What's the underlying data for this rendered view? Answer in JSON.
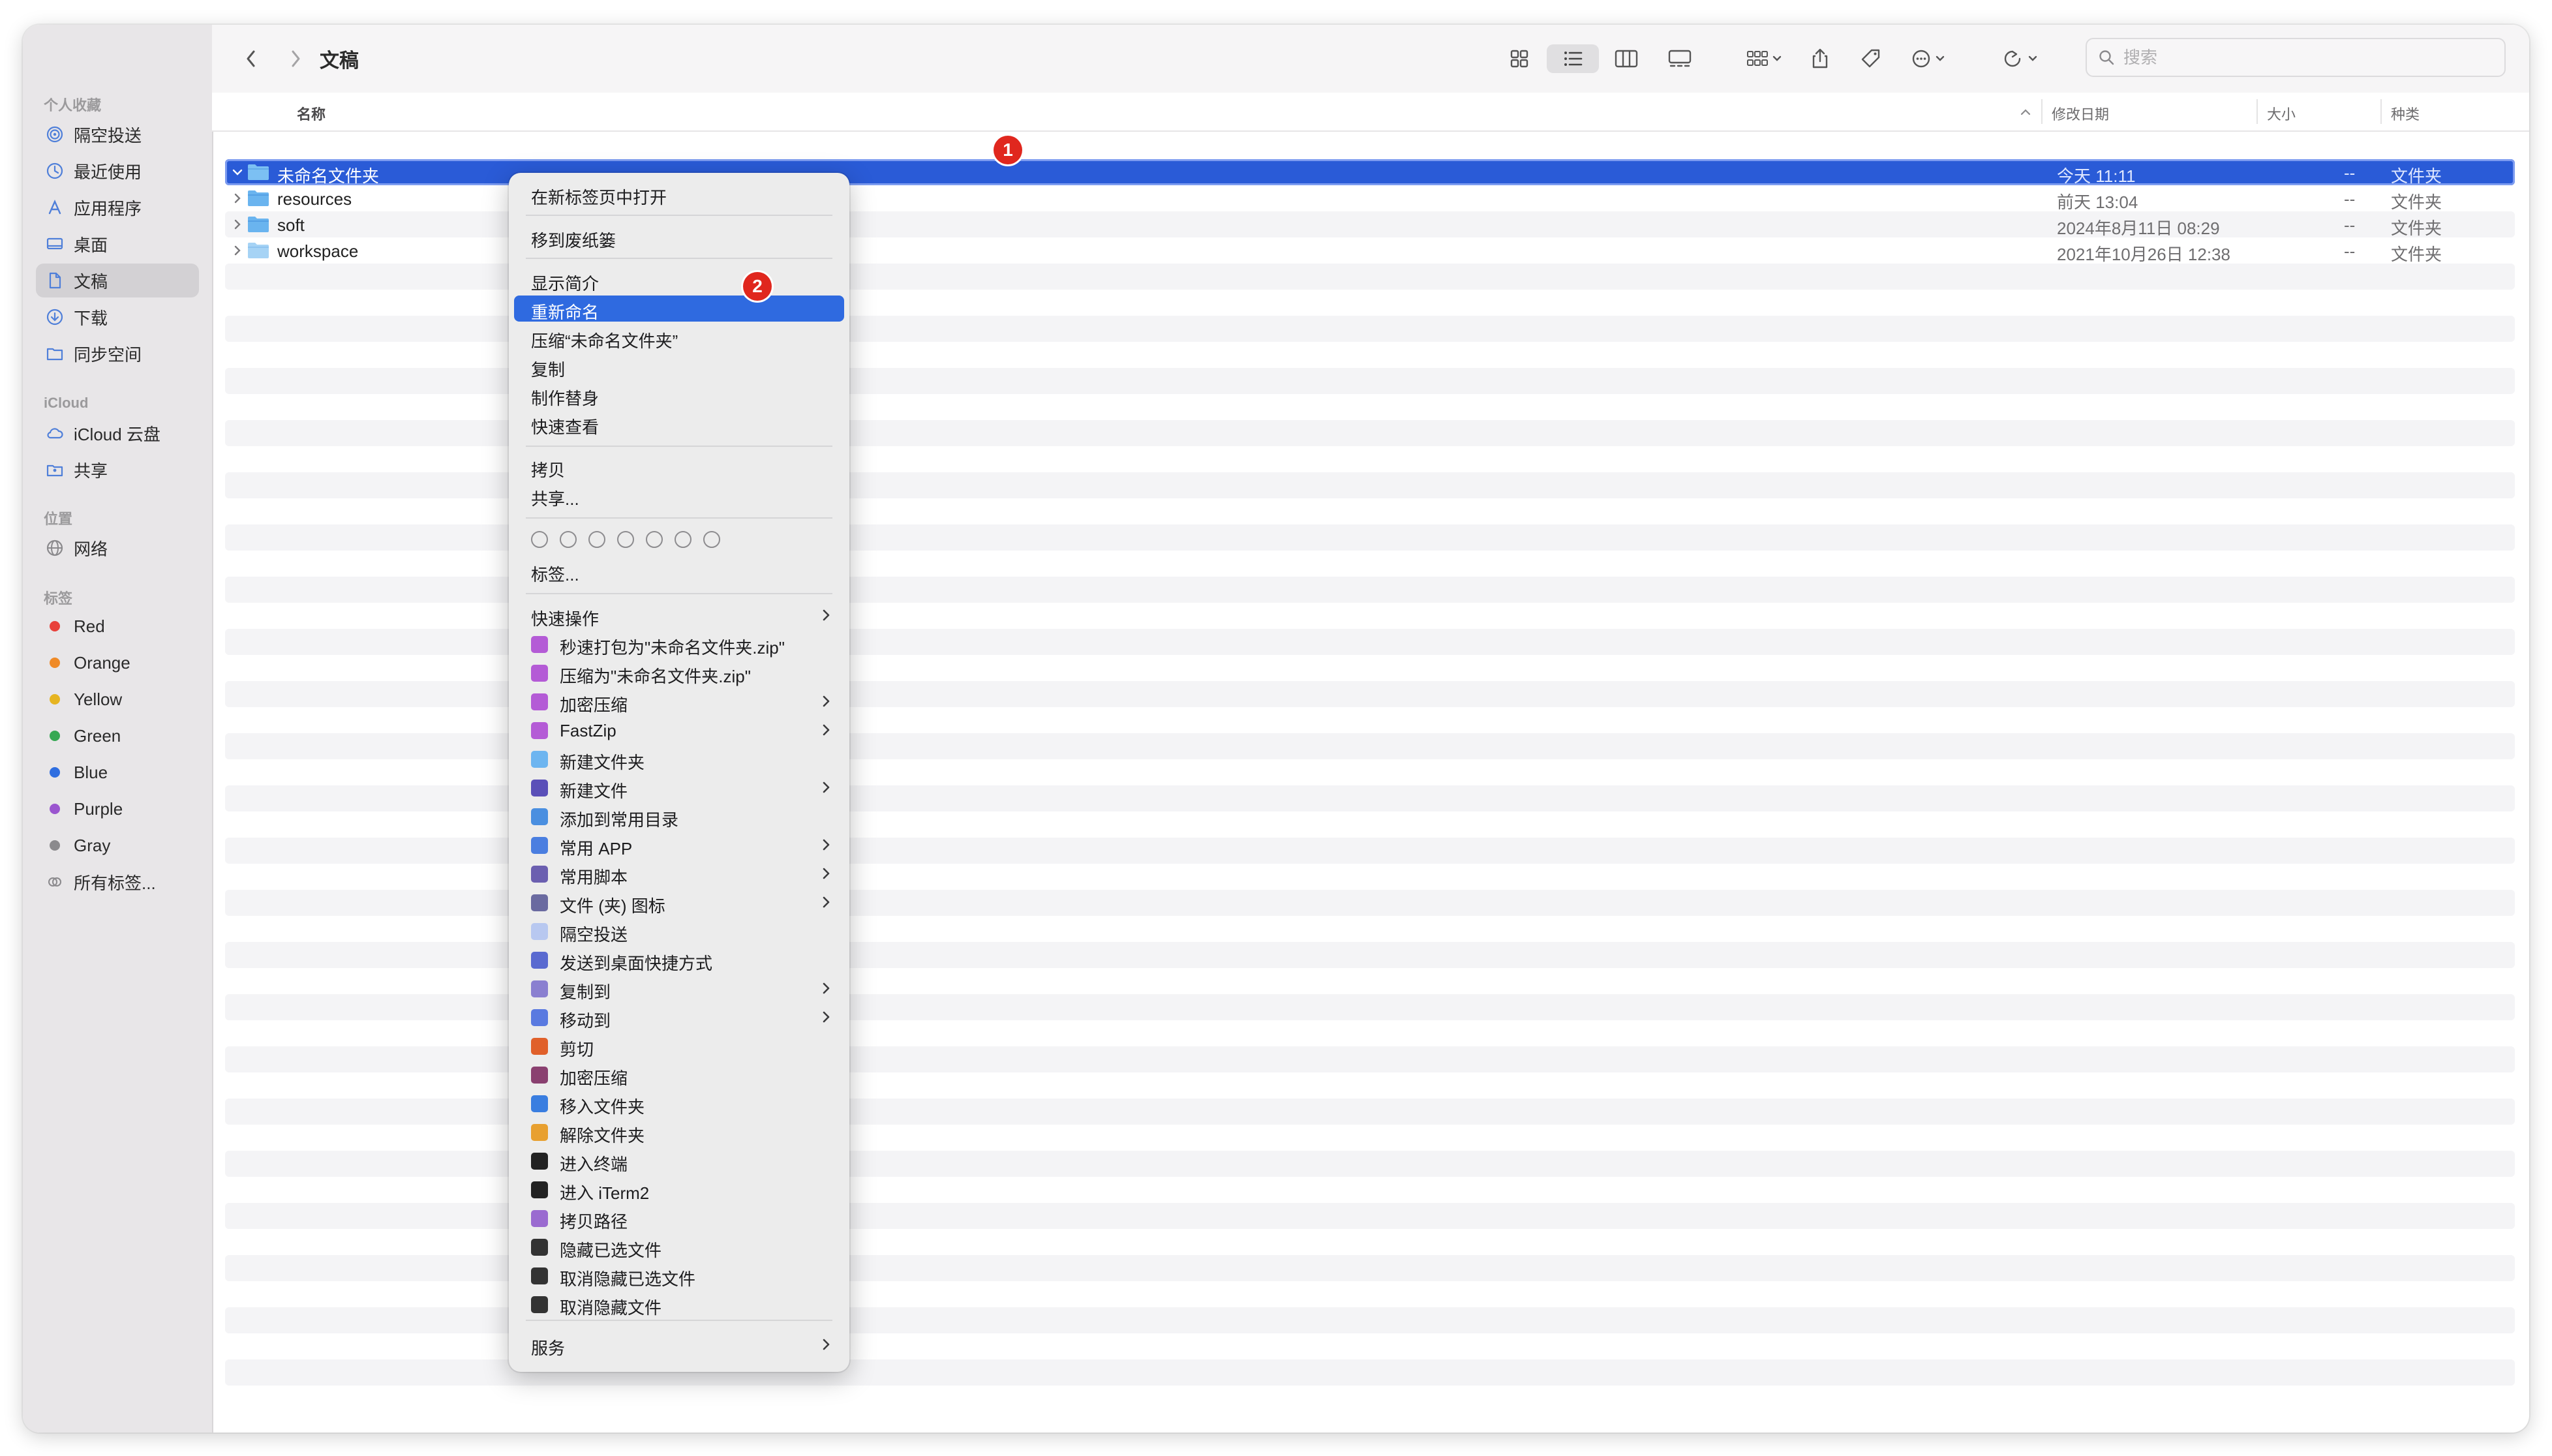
{
  "sidebar": {
    "sections": [
      {
        "title": "个人收藏",
        "items": [
          "隔空投送",
          "最近使用",
          "应用程序",
          "桌面",
          "文稿",
          "下载",
          "同步空间"
        ]
      },
      {
        "title": "iCloud",
        "items": [
          "iCloud 云盘",
          "共享"
        ]
      },
      {
        "title": "位置",
        "items": [
          "网络"
        ]
      },
      {
        "title": "标签",
        "items": [
          "Red",
          "Orange",
          "Yellow",
          "Green",
          "Blue",
          "Purple",
          "Gray",
          "所有标签..."
        ]
      }
    ],
    "selected": "文稿",
    "tag_colors": {
      "Red": "#e8413b",
      "Orange": "#ef8a27",
      "Yellow": "#e6b421",
      "Green": "#35a852",
      "Blue": "#2f6ee0",
      "Purple": "#9a55cf",
      "Gray": "#8b8a8d"
    }
  },
  "toolbar": {
    "title": "文稿",
    "search_placeholder": "搜索"
  },
  "columns": {
    "name": "名称",
    "modified": "修改日期",
    "size": "大小",
    "kind": "种类"
  },
  "files": [
    {
      "name": "未命名文件夹",
      "modified": "今天 11:11",
      "size": "--",
      "kind": "文件夹",
      "selected": true,
      "expanded": true
    },
    {
      "name": "resources",
      "modified": "前天 13:04",
      "size": "--",
      "kind": "文件夹"
    },
    {
      "name": "soft",
      "modified": "2024年8月11日 08:29",
      "size": "--",
      "kind": "文件夹"
    },
    {
      "name": "workspace",
      "modified": "2021年10月26日 12:38",
      "size": "--",
      "kind": "文件夹"
    }
  ],
  "badges": {
    "one": "1",
    "two": "2"
  },
  "context_menu": {
    "open_new_tab": "在新标签页中打开",
    "move_to_trash": "移到废纸篓",
    "get_info": "显示简介",
    "rename": "重新命名",
    "compress": "压缩“未命名文件夹”",
    "duplicate": "复制",
    "make_alias": "制作替身",
    "quick_look": "快速查看",
    "copy": "拷贝",
    "share": "共享...",
    "tags": "标签...",
    "quick_actions": "快速操作",
    "ext_items": [
      {
        "label": "秒速打包为\"未命名文件夹.zip\"",
        "icon": "fastzip-icon",
        "color": "#b45bd6",
        "sub": false
      },
      {
        "label": "压缩为\"未命名文件夹.zip\"",
        "icon": "fastzip-icon",
        "color": "#b45bd6",
        "sub": false
      },
      {
        "label": "加密压缩",
        "icon": "fastzip-icon",
        "color": "#b45bd6",
        "sub": true
      },
      {
        "label": "FastZip",
        "icon": "fastzip-icon",
        "color": "#b45bd6",
        "sub": true
      },
      {
        "label": "新建文件夹",
        "icon": "folder-icon",
        "color": "#6db5f0",
        "sub": false
      },
      {
        "label": "新建文件",
        "icon": "new-file-icon",
        "color": "#5a4fb8",
        "sub": true
      },
      {
        "label": "添加到常用目录",
        "icon": "folder-star-icon",
        "color": "#4a8fe0",
        "sub": false
      },
      {
        "label": "常用 APP",
        "icon": "app-store-icon",
        "color": "#4a7ee0",
        "sub": true
      },
      {
        "label": "常用脚本",
        "icon": "script-icon",
        "color": "#6b5fb0",
        "sub": true
      },
      {
        "label": "文件 (夹) 图标",
        "icon": "heart-image-icon",
        "color": "#6a6aa0",
        "sub": true
      },
      {
        "label": "隔空投送",
        "icon": "airdrop-icon",
        "color": "#b8c8f0",
        "sub": false
      },
      {
        "label": "发送到桌面快捷方式",
        "icon": "shortcut-icon",
        "color": "#5a6ad0",
        "sub": false
      },
      {
        "label": "复制到",
        "icon": "copy-to-icon",
        "color": "#8a7fd0",
        "sub": true
      },
      {
        "label": "移动到",
        "icon": "move-to-icon",
        "color": "#5a7ae0",
        "sub": true
      },
      {
        "label": "剪切",
        "icon": "scissors-icon",
        "color": "#e0602a",
        "sub": false
      },
      {
        "label": "加密压缩",
        "icon": "zip-lock-icon",
        "color": "#8a4070",
        "sub": false
      },
      {
        "label": "移入文件夹",
        "icon": "move-in-icon",
        "color": "#3a7ee0",
        "sub": false
      },
      {
        "label": "解除文件夹",
        "icon": "unfolder-icon",
        "color": "#e8a030",
        "sub": false
      },
      {
        "label": "进入终端",
        "icon": "terminal-icon",
        "color": "#222222",
        "sub": false
      },
      {
        "label": "进入 iTerm2",
        "icon": "iterm-icon",
        "color": "#222222",
        "sub": false
      },
      {
        "label": "拷贝路径",
        "icon": "copy-path-icon",
        "color": "#9a6ad0",
        "sub": false
      },
      {
        "label": "隐藏已选文件",
        "icon": "hide-eye-icon",
        "color": "#333333",
        "sub": false
      },
      {
        "label": "取消隐藏已选文件",
        "icon": "eye-icon",
        "color": "#333333",
        "sub": false
      },
      {
        "label": "取消隐藏文件",
        "icon": "eye-icon",
        "color": "#333333",
        "sub": false
      }
    ],
    "services": "服务"
  }
}
